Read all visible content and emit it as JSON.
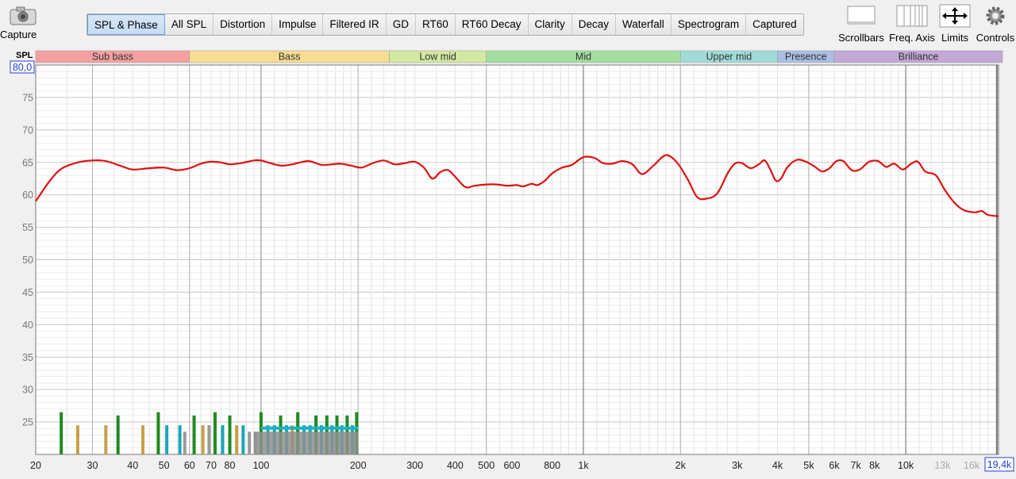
{
  "capture_label": "Capture",
  "tabs": [
    "SPL & Phase",
    "All SPL",
    "Distortion",
    "Impulse",
    "Filtered IR",
    "GD",
    "RT60",
    "RT60 Decay",
    "Clarity",
    "Decay",
    "Waterfall",
    "Spectrogram",
    "Captured"
  ],
  "active_tab": "SPL & Phase",
  "right_tools": {
    "scrollbars": "Scrollbars",
    "freq_axis": "Freq. Axis",
    "limits": "Limits",
    "controls": "Controls"
  },
  "y_axis_label": "SPL",
  "y_top_value": "80,0",
  "x_right_value": "19,4k",
  "bands": [
    {
      "label": "Sub bass",
      "f0": 20,
      "f1": 60,
      "color": "#f4a0a0"
    },
    {
      "label": "Bass",
      "f0": 60,
      "f1": 250,
      "color": "#f7dc92"
    },
    {
      "label": "Low mid",
      "f0": 250,
      "f1": 500,
      "color": "#d3e8a0"
    },
    {
      "label": "Mid",
      "f0": 500,
      "f1": 2000,
      "color": "#a3dfa0"
    },
    {
      "label": "Upper mid",
      "f0": 2000,
      "f1": 4000,
      "color": "#9fdcd8"
    },
    {
      "label": "Presence",
      "f0": 4000,
      "f1": 6000,
      "color": "#a9bfe3"
    },
    {
      "label": "Brilliance",
      "f0": 6000,
      "f1": 20000,
      "color": "#c3a8d6"
    }
  ],
  "chart_data": {
    "type": "line",
    "xlabel": "",
    "ylabel": "SPL",
    "x_scale": "log",
    "xlim": [
      20,
      19400
    ],
    "ylim": [
      20,
      80
    ],
    "grid": true,
    "y_ticks": [
      25,
      30,
      35,
      40,
      45,
      50,
      55,
      60,
      65,
      70,
      75
    ],
    "x_ticks": [
      {
        "v": 20,
        "t": "20"
      },
      {
        "v": 30,
        "t": "30"
      },
      {
        "v": 40,
        "t": "40"
      },
      {
        "v": 50,
        "t": "50"
      },
      {
        "v": 60,
        "t": "60"
      },
      {
        "v": 70,
        "t": "70"
      },
      {
        "v": 80,
        "t": "80"
      },
      {
        "v": 100,
        "t": "100"
      },
      {
        "v": 200,
        "t": "200"
      },
      {
        "v": 300,
        "t": "300"
      },
      {
        "v": 400,
        "t": "400"
      },
      {
        "v": 500,
        "t": "500"
      },
      {
        "v": 600,
        "t": "600"
      },
      {
        "v": 800,
        "t": "800"
      },
      {
        "v": 1000,
        "t": "1k"
      },
      {
        "v": 2000,
        "t": "2k"
      },
      {
        "v": 3000,
        "t": "3k"
      },
      {
        "v": 4000,
        "t": "4k"
      },
      {
        "v": 5000,
        "t": "5k"
      },
      {
        "v": 6000,
        "t": "6k"
      },
      {
        "v": 7000,
        "t": "7k"
      },
      {
        "v": 8000,
        "t": "8k"
      },
      {
        "v": 10000,
        "t": "10k"
      },
      {
        "v": 13000,
        "t": "13k"
      },
      {
        "v": 16000,
        "t": "16k"
      }
    ],
    "series": [
      {
        "color": "#e01010",
        "points": [
          [
            20,
            59
          ],
          [
            22,
            62
          ],
          [
            24,
            64
          ],
          [
            27,
            65
          ],
          [
            30,
            65.3
          ],
          [
            33,
            65.2
          ],
          [
            37,
            64.4
          ],
          [
            40,
            63.9
          ],
          [
            45,
            64.1
          ],
          [
            50,
            64.2
          ],
          [
            55,
            63.8
          ],
          [
            60,
            64.1
          ],
          [
            65,
            64.8
          ],
          [
            70,
            65.1
          ],
          [
            75,
            65
          ],
          [
            80,
            64.7
          ],
          [
            87,
            64.9
          ],
          [
            95,
            65.3
          ],
          [
            100,
            65.3
          ],
          [
            105,
            65
          ],
          [
            115,
            64.5
          ],
          [
            125,
            64.7
          ],
          [
            140,
            65.2
          ],
          [
            155,
            64.6
          ],
          [
            175,
            64.8
          ],
          [
            190,
            64.5
          ],
          [
            205,
            64.2
          ],
          [
            220,
            64.8
          ],
          [
            240,
            65.3
          ],
          [
            260,
            64.7
          ],
          [
            280,
            64.9
          ],
          [
            300,
            65.1
          ],
          [
            320,
            64.2
          ],
          [
            340,
            62.5
          ],
          [
            360,
            63.5
          ],
          [
            380,
            63.8
          ],
          [
            400,
            62.8
          ],
          [
            430,
            61.2
          ],
          [
            460,
            61.4
          ],
          [
            500,
            61.6
          ],
          [
            540,
            61.6
          ],
          [
            580,
            61.4
          ],
          [
            620,
            61.5
          ],
          [
            650,
            61.3
          ],
          [
            690,
            61.7
          ],
          [
            720,
            61.5
          ],
          [
            760,
            62.2
          ],
          [
            800,
            63.3
          ],
          [
            860,
            64.2
          ],
          [
            920,
            64.6
          ],
          [
            1000,
            65.8
          ],
          [
            1080,
            65.7
          ],
          [
            1150,
            64.9
          ],
          [
            1230,
            64.8
          ],
          [
            1320,
            65.2
          ],
          [
            1420,
            64.7
          ],
          [
            1520,
            63.2
          ],
          [
            1650,
            64.5
          ],
          [
            1800,
            66.1
          ],
          [
            1950,
            65
          ],
          [
            2100,
            62.5
          ],
          [
            2250,
            59.7
          ],
          [
            2400,
            59.4
          ],
          [
            2600,
            60.2
          ],
          [
            2800,
            63.3
          ],
          [
            2950,
            64.8
          ],
          [
            3100,
            64.9
          ],
          [
            3300,
            64.1
          ],
          [
            3500,
            64.7
          ],
          [
            3650,
            65.3
          ],
          [
            3800,
            63.9
          ],
          [
            3950,
            62.2
          ],
          [
            4100,
            62.5
          ],
          [
            4300,
            64.3
          ],
          [
            4600,
            65.4
          ],
          [
            4900,
            65.1
          ],
          [
            5200,
            64.4
          ],
          [
            5500,
            63.6
          ],
          [
            5800,
            64.1
          ],
          [
            6100,
            65.2
          ],
          [
            6400,
            65.2
          ],
          [
            6800,
            63.8
          ],
          [
            7200,
            63.9
          ],
          [
            7700,
            65.1
          ],
          [
            8200,
            65.2
          ],
          [
            8700,
            64.3
          ],
          [
            9200,
            64.8
          ],
          [
            9800,
            63.9
          ],
          [
            10400,
            64.8
          ],
          [
            10900,
            65.1
          ],
          [
            11500,
            63.6
          ],
          [
            12400,
            63
          ],
          [
            13200,
            60.8
          ],
          [
            14200,
            58.7
          ],
          [
            15200,
            57.6
          ],
          [
            16400,
            57.3
          ],
          [
            17200,
            57.5
          ],
          [
            18000,
            56.9
          ],
          [
            19400,
            56.7
          ]
        ]
      }
    ],
    "bars": [
      {
        "f": 24,
        "h": 26.5,
        "c": "#1f8a1f"
      },
      {
        "f": 27,
        "h": 24.5,
        "c": "#c8a04a"
      },
      {
        "f": 33,
        "h": 24.5,
        "c": "#c8a04a"
      },
      {
        "f": 36,
        "h": 26,
        "c": "#1f8a1f"
      },
      {
        "f": 43,
        "h": 24.5,
        "c": "#c8a04a"
      },
      {
        "f": 48,
        "h": 26.5,
        "c": "#1f8a1f"
      },
      {
        "f": 51,
        "h": 24.5,
        "c": "#1aa6b8"
      },
      {
        "f": 56,
        "h": 24.5,
        "c": "#1aa6b8"
      },
      {
        "f": 58,
        "h": 23.5,
        "c": "#9a9a9a"
      },
      {
        "f": 62,
        "h": 26,
        "c": "#1f8a1f"
      },
      {
        "f": 66,
        "h": 24.5,
        "c": "#c8a04a"
      },
      {
        "f": 69,
        "h": 24.5,
        "c": "#9a9a9a"
      },
      {
        "f": 72,
        "h": 26.5,
        "c": "#1f8a1f"
      },
      {
        "f": 76,
        "h": 24.5,
        "c": "#1aa6b8"
      },
      {
        "f": 80,
        "h": 26,
        "c": "#1f8a1f"
      },
      {
        "f": 84,
        "h": 24.5,
        "c": "#c8a04a"
      },
      {
        "f": 88,
        "h": 24.5,
        "c": "#1aa6b8"
      },
      {
        "f": 92,
        "h": 23.5,
        "c": "#9a9a9a"
      },
      {
        "f": 96,
        "h": 23.5,
        "c": "#9a9a9a"
      },
      {
        "f": 100,
        "h": 26.5,
        "c": "#1f8a1f"
      },
      {
        "f": 105,
        "h": 24.5,
        "c": "#1aa6b8"
      },
      {
        "f": 110,
        "h": 24.5,
        "c": "#1aa6b8"
      },
      {
        "f": 115,
        "h": 26,
        "c": "#1f8a1f"
      },
      {
        "f": 120,
        "h": 24.5,
        "c": "#1aa6b8"
      },
      {
        "f": 125,
        "h": 24.5,
        "c": "#c8a04a"
      },
      {
        "f": 130,
        "h": 26.5,
        "c": "#1f8a1f"
      },
      {
        "f": 136,
        "h": 24.5,
        "c": "#1aa6b8"
      },
      {
        "f": 142,
        "h": 24.5,
        "c": "#1aa6b8"
      },
      {
        "f": 148,
        "h": 26,
        "c": "#1f8a1f"
      },
      {
        "f": 154,
        "h": 24.5,
        "c": "#1aa6b8"
      },
      {
        "f": 160,
        "h": 26,
        "c": "#1f8a1f"
      },
      {
        "f": 166,
        "h": 24.5,
        "c": "#1aa6b8"
      },
      {
        "f": 172,
        "h": 26,
        "c": "#1f8a1f"
      },
      {
        "f": 178,
        "h": 24.5,
        "c": "#1aa6b8"
      },
      {
        "f": 185,
        "h": 26,
        "c": "#1f8a1f"
      },
      {
        "f": 192,
        "h": 24.5,
        "c": "#1aa6b8"
      },
      {
        "f": 198,
        "h": 26.5,
        "c": "#1f8a1f"
      }
    ]
  }
}
